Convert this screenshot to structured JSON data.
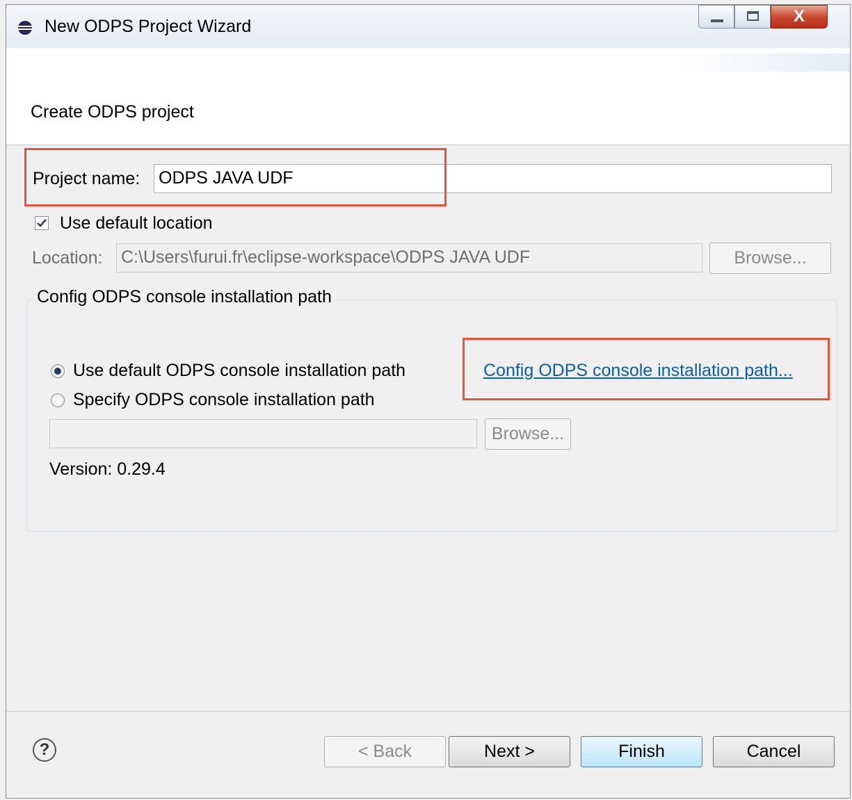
{
  "window": {
    "title": "New ODPS Project Wizard",
    "controls": {
      "close_glyph": "X"
    }
  },
  "header": {
    "title": "Create ODPS project"
  },
  "form": {
    "project_name_label": "Project name:",
    "project_name_value": "ODPS JAVA UDF",
    "use_default_location_label": "Use default location",
    "use_default_location_checked": true,
    "location_label": "Location:",
    "location_value": "C:\\Users\\furui.fr\\eclipse-workspace\\ODPS JAVA UDF",
    "location_browse_label": "Browse..."
  },
  "console_group": {
    "title": "Config ODPS console installation path",
    "option_default_label": "Use default ODPS console installation path",
    "option_specify_label": "Specify ODPS console installation path",
    "selected_option": "default",
    "path_value": "",
    "path_browse_label": "Browse...",
    "config_link_label": "Config ODPS console installation path...",
    "version_text": "Version: 0.29.4"
  },
  "footer": {
    "help_glyph": "?",
    "back_label": "< Back",
    "next_label": "Next >",
    "finish_label": "Finish",
    "cancel_label": "Cancel"
  },
  "colors": {
    "annotation": "#e8533a",
    "link": "#0b5ea9",
    "default_button_border": "#3c7fb1"
  }
}
